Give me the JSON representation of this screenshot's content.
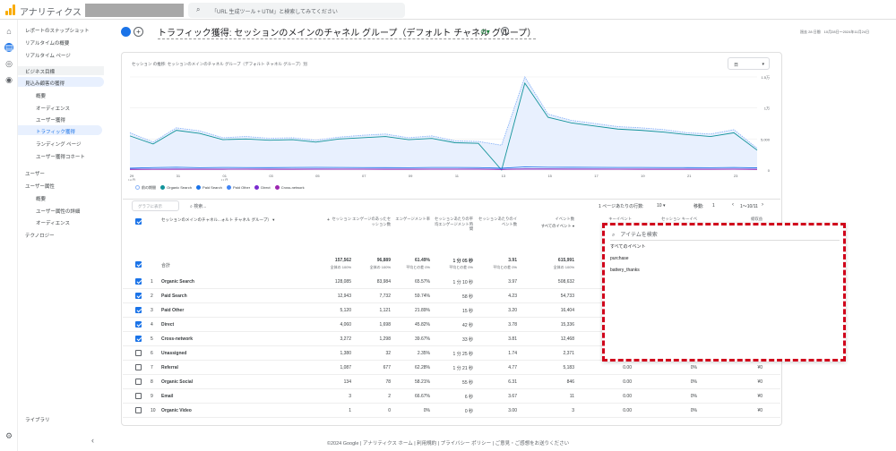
{
  "app": {
    "name": "アナリティクス",
    "search_placeholder": "「URL 生成ツール + UTM」と検索してみてください"
  },
  "nav": {
    "items": [
      "レポートのスナップショット",
      "リアルタイムの概要",
      "リアルタイム ページ"
    ],
    "business": "ビジネス目標",
    "section": "見込み顧客の獲得",
    "sub": [
      "概要",
      "オーディエンス",
      "ユーザー獲得",
      "トラフィック獲得",
      "ランディング ページ",
      "ユーザー獲得コホート"
    ],
    "user": "ユーザー",
    "user_attr": "ユーザー属性",
    "user_sub": [
      "概要",
      "ユーザー属性の詳細",
      "オーディエンス"
    ],
    "tech": "テクノロジー",
    "library": "ライブラリ"
  },
  "header": {
    "title": "トラフィック獲得: セッションのメインのチャネル グループ（デフォルト チャネル グループ）",
    "daterange": "過去 28 日間　10月28日～2024年11月24日"
  },
  "chart": {
    "caption": "セッション の推移: セッションのメインのチャネル グループ（デフォルト チャネル グループ）別",
    "period": "日",
    "yticks": [
      "1.5万",
      "1万",
      "5,000",
      "0"
    ],
    "xticks": [
      "29\n10月",
      "31",
      "01\n11月",
      "03",
      "05",
      "07",
      "09",
      "11",
      "13",
      "15",
      "17",
      "19",
      "21",
      "23"
    ],
    "legend": [
      "前の期間",
      "Organic Search",
      "Paid Search",
      "Paid Other",
      "Direct",
      "Cross-network"
    ]
  },
  "chart_data": {
    "type": "line",
    "series": [
      {
        "name": "前の期間",
        "values": [
          6000,
          4500,
          6800,
          6300,
          5200,
          5400,
          5100,
          5200,
          4800,
          5300,
          5600,
          5800,
          5200,
          5500,
          4700,
          4600,
          4000,
          15000,
          9000,
          8000,
          7500,
          7000,
          6800,
          6500,
          6000,
          5800,
          6500,
          3500
        ]
      },
      {
        "name": "Organic Search",
        "values": [
          5500,
          4200,
          6400,
          5900,
          4900,
          5000,
          4800,
          4900,
          4500,
          5000,
          5200,
          5400,
          4900,
          5100,
          4400,
          4300,
          0,
          14000,
          8500,
          7600,
          7100,
          6600,
          6400,
          6100,
          5700,
          5400,
          6000,
          3200
        ]
      },
      {
        "name": "Paid Search",
        "values": [
          300,
          400,
          450,
          380,
          420,
          400,
          390,
          410,
          430,
          420,
          400,
          390,
          380,
          420,
          410,
          400,
          300,
          500,
          450,
          440,
          430,
          420,
          410,
          400,
          390,
          380,
          420,
          350
        ]
      },
      {
        "name": "Paid Other",
        "values": [
          150,
          160,
          170,
          150,
          160,
          165,
          155,
          160,
          170,
          165,
          160,
          155,
          150,
          160,
          165,
          170,
          120,
          200,
          180,
          175,
          170,
          165,
          160,
          155,
          150,
          145,
          160,
          130
        ]
      },
      {
        "name": "Direct",
        "values": [
          120,
          130,
          140,
          135,
          140,
          150,
          145,
          140,
          150,
          160,
          150,
          145,
          140,
          150,
          155,
          160,
          110,
          180,
          170,
          165,
          160,
          155,
          150,
          145,
          140,
          135,
          150,
          120
        ]
      },
      {
        "name": "Cross-network",
        "values": [
          100,
          110,
          120,
          115,
          120,
          125,
          120,
          118,
          125,
          130,
          125,
          120,
          118,
          125,
          128,
          130,
          90,
          150,
          140,
          135,
          130,
          125,
          120,
          118,
          115,
          110,
          125,
          100
        ]
      }
    ],
    "ylim": [
      0,
      15000
    ]
  },
  "table": {
    "plot_btn": "グラフに表示",
    "search": "検索...",
    "rows_per_page": "1 ページあたりの行数:",
    "rpp": "10",
    "goto": "移動:",
    "goto_val": "1",
    "range": "1～10/11",
    "dim": "セッションのメインのチャネル...ォルト チャネル グループ）",
    "cols": [
      "セッション",
      "エンゲージのあったセッション数",
      "エンゲージメント率",
      "セッションあたりの平均エンゲージメント時間",
      "セッションあたりのイベント数",
      "イベント数",
      "キーイベント",
      "セッション キーイベント",
      "総収益"
    ],
    "event_sel": "すべてのイベント",
    "total": {
      "label": "合計",
      "v": [
        "157,562",
        "96,889",
        "61.49%",
        "1 分 05 秒",
        "3.91",
        "615,991"
      ],
      "s": [
        "全体の 100%",
        "全体の 100%",
        "平均との差 0%",
        "平均との差 0%",
        "平均との差 0%",
        "全体の 100%"
      ]
    },
    "rows": [
      {
        "n": "1",
        "name": "Organic Search",
        "v": [
          "128,085",
          "83,984",
          "65.57%",
          "1 分 10 秒",
          "3.97",
          "508,632",
          "",
          "",
          ""
        ],
        "c": true
      },
      {
        "n": "2",
        "name": "Paid Search",
        "v": [
          "12,943",
          "7,732",
          "59.74%",
          "58 秒",
          "4.23",
          "54,733",
          "",
          "",
          ""
        ],
        "c": true
      },
      {
        "n": "3",
        "name": "Paid Other",
        "v": [
          "5,120",
          "1,121",
          "21.89%",
          "15 秒",
          "3.20",
          "16,404",
          "",
          "",
          ""
        ],
        "c": true
      },
      {
        "n": "4",
        "name": "Direct",
        "v": [
          "4,060",
          "1,698",
          "45.82%",
          "42 秒",
          "3.78",
          "15,336",
          "",
          "",
          ""
        ],
        "c": true
      },
      {
        "n": "5",
        "name": "Cross-network",
        "v": [
          "3,272",
          "1,298",
          "39.67%",
          "33 秒",
          "3.81",
          "12,468",
          "",
          "",
          ""
        ],
        "c": true
      },
      {
        "n": "6",
        "name": "Unassigned",
        "v": [
          "1,380",
          "32",
          "2.35%",
          "1 分 25 秒",
          "1.74",
          "2,371",
          "",
          "",
          ""
        ],
        "c": false
      },
      {
        "n": "7",
        "name": "Referral",
        "v": [
          "1,087",
          "677",
          "62.28%",
          "1 分 21 秒",
          "4.77",
          "5,183",
          "0.00",
          "0%",
          "¥0"
        ],
        "c": false
      },
      {
        "n": "8",
        "name": "Organic Social",
        "v": [
          "134",
          "78",
          "58.21%",
          "55 秒",
          "6.31",
          "846",
          "0.00",
          "0%",
          "¥0"
        ],
        "c": false
      },
      {
        "n": "9",
        "name": "Email",
        "v": [
          "3",
          "2",
          "66.67%",
          "6 秒",
          "3.67",
          "11",
          "0.00",
          "0%",
          "¥0"
        ],
        "c": false
      },
      {
        "n": "10",
        "name": "Organic Video",
        "v": [
          "1",
          "0",
          "0%",
          "0 秒",
          "3.00",
          "3",
          "0.00",
          "0%",
          "¥0"
        ],
        "c": false
      }
    ]
  },
  "dropdown": {
    "placeholder": "アイテムを検索",
    "options": [
      "すべてのイベント",
      "purchase",
      "battery_thanks"
    ]
  },
  "footer": "©2024 Google | アナリティクス ホーム | 利用規約 | プライバシー ポリシー | ご意見・ご感想をお送りください"
}
